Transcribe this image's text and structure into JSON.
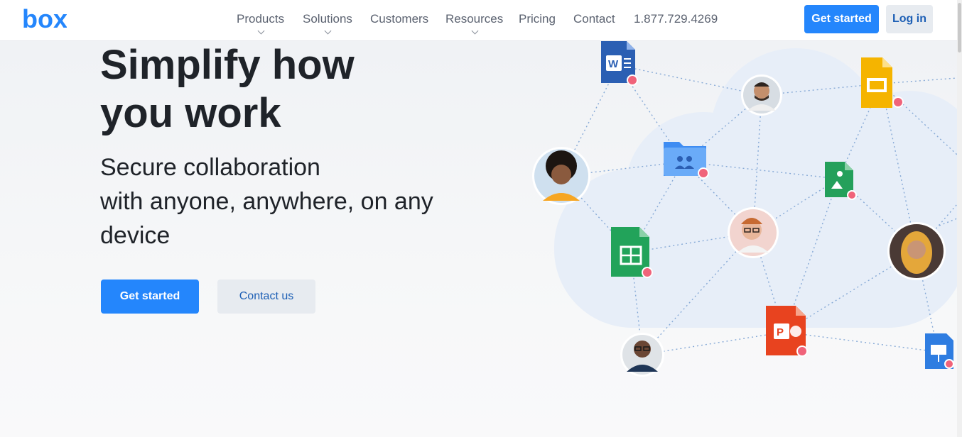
{
  "brand": {
    "logo_text": "box",
    "color": "#2486fc"
  },
  "nav": {
    "items": [
      {
        "label": "Products",
        "has_dropdown": true
      },
      {
        "label": "Solutions",
        "has_dropdown": true
      },
      {
        "label": "Customers",
        "has_dropdown": false
      },
      {
        "label": "Resources",
        "has_dropdown": true
      },
      {
        "label": "Pricing",
        "has_dropdown": false
      },
      {
        "label": "Contact",
        "has_dropdown": false
      }
    ],
    "phone": "1.877.729.4269"
  },
  "header_actions": {
    "get_started": "Get started",
    "log_in": "Log in"
  },
  "hero": {
    "headline_line1": "Simplify how",
    "headline_line2": "you work",
    "subhead_line1": "Secure collaboration",
    "subhead_line2": "with anyone, anywhere, on any",
    "subhead_line3": "device",
    "primary_cta": "Get started",
    "secondary_cta": "Contact us"
  },
  "illustration": {
    "file_icons": [
      "word-doc-icon",
      "slides-icon",
      "shared-folder-icon",
      "image-file-icon",
      "spreadsheet-icon",
      "powerpoint-icon",
      "keynote-icon"
    ],
    "avatars": [
      "avatar-man-beard",
      "avatar-woman-curly",
      "avatar-man-glasses",
      "avatar-woman-hijab",
      "avatar-man-suit"
    ],
    "lock_badge_color": "#f0637a"
  },
  "colors": {
    "primary": "#2486fc",
    "text": "#1f2329",
    "nav_text": "#5b6270",
    "secondary_btn_bg": "#e7ebf0"
  }
}
